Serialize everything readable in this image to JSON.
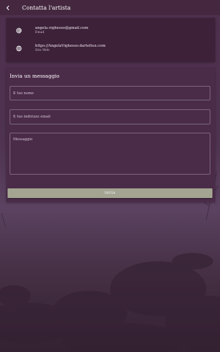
{
  "topbar": {
    "title": "Contatta l'artista",
    "back_icon": "arrow-left-icon"
  },
  "contact_info": [
    {
      "icon": "at-sign-icon",
      "value": "angela.vighesso@gmail.com",
      "label": "Email"
    },
    {
      "icon": "globe-icon",
      "value": "https://AngelaVighesso.darteltux.com",
      "label": "Sito Web"
    }
  ],
  "form": {
    "title": "Invia un messaggio",
    "name_placeholder": "Il tuo nome",
    "email_placeholder": "Il tuo indirizzo email",
    "message_placeholder": "Messaggio",
    "send_label": "INVIA"
  },
  "colors": {
    "topbar": "#45283f",
    "card": "#3c2139",
    "form_card": "#4a2b48",
    "button": "#a3a492"
  }
}
